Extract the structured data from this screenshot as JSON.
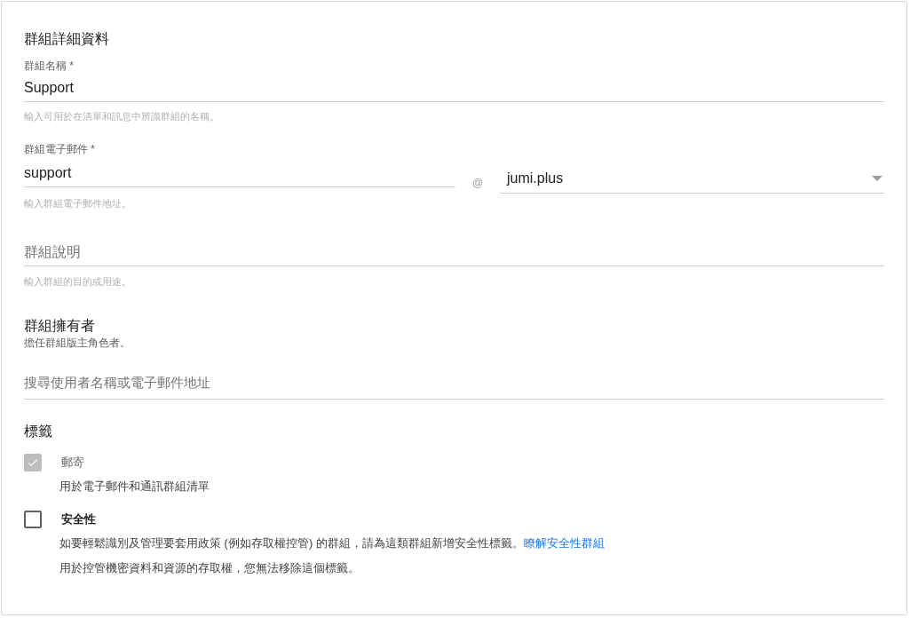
{
  "section_title": "群組詳細資料",
  "name_field": {
    "label": "群組名稱 *",
    "value": "Support",
    "hint": "輸入可用於在清單和訊息中辨識群組的名稱。"
  },
  "email_field": {
    "label": "群組電子郵件 *",
    "value": "support",
    "at": "@",
    "domain": "jumi.plus",
    "hint": "輸入群組電子郵件地址。"
  },
  "description_field": {
    "placeholder": "群組說明",
    "hint": "輸入群組的目的或用途。"
  },
  "owners": {
    "title": "群組擁有者",
    "subtitle": "擔任群組版主角色者。",
    "search_placeholder": "搜尋使用者名稱或電子郵件地址"
  },
  "labels": {
    "title": "標籤",
    "items": [
      {
        "label": "郵寄",
        "checked": true,
        "disabled": true,
        "description": "用於電子郵件和通訊群組清單"
      },
      {
        "label": "安全性",
        "checked": false,
        "disabled": false,
        "description": "如要輕鬆識別及管理要套用政策 (例如存取權控管) 的群組，請為這類群組新增安全性標籤。",
        "link": "瞭解安全性群組",
        "note": "用於控管機密資料和資源的存取權，您無法移除這個標籤。"
      }
    ]
  }
}
